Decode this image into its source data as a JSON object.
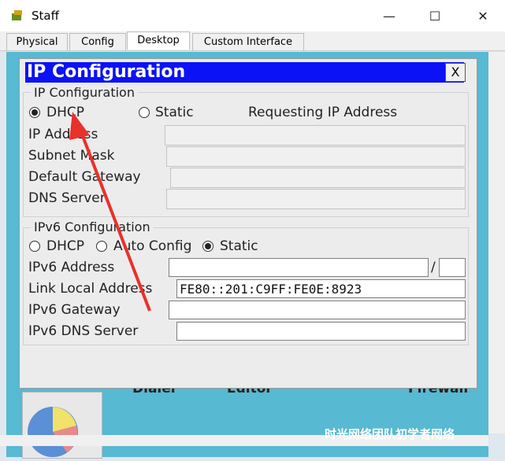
{
  "window": {
    "title": "Staff",
    "minimize": "—",
    "maximize": "☐",
    "close": "✕"
  },
  "tabs": [
    "Physical",
    "Config",
    "Desktop",
    "Custom Interface"
  ],
  "desktop": {
    "labels": [
      "Dialer",
      "Editor",
      "Firewall"
    ],
    "watermark": "时光网络团队初学者网络"
  },
  "dialog": {
    "title": "IP Configuration",
    "close": "X",
    "ipv4": {
      "group_label": "IP Configuration",
      "dhcp_label": "DHCP",
      "static_label": "Static",
      "status": "Requesting IP Address",
      "mode": "DHCP",
      "ip_label": "IP Address",
      "mask_label": "Subnet Mask",
      "gateway_label": "Default Gateway",
      "dns_label": "DNS Server"
    },
    "ipv6": {
      "group_label": "IPv6 Configuration",
      "dhcp_label": "DHCP",
      "auto_label": "Auto Config",
      "static_label": "Static",
      "mode": "Static",
      "address_label": "IPv6 Address",
      "slash": "/",
      "link_local_label": "Link Local Address",
      "link_local_value": "FE80::201:C9FF:FE0E:8923",
      "gateway_label": "IPv6 Gateway",
      "dns_label": "IPv6 DNS Server"
    }
  }
}
